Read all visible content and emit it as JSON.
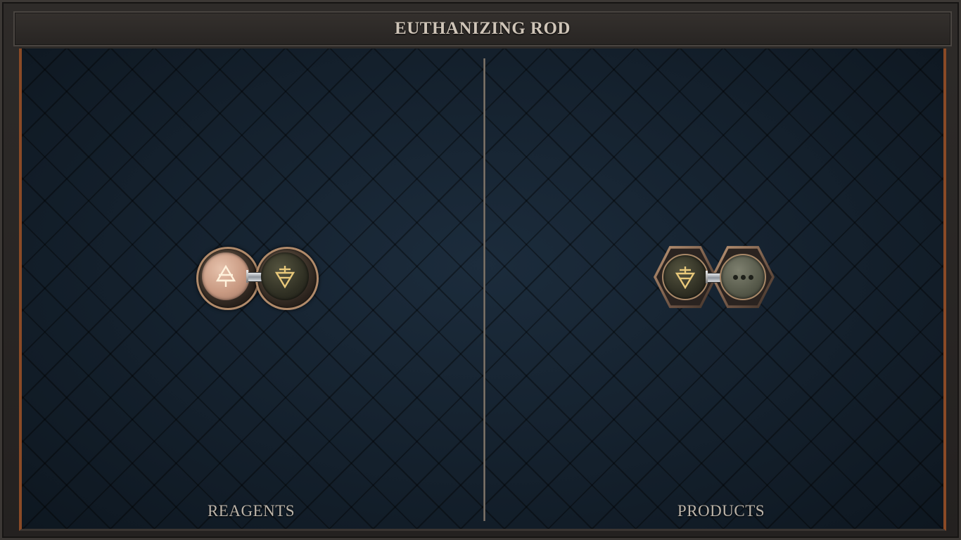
{
  "title": "EUTHANIZING ROD",
  "panels": {
    "left_label": "REAGENTS",
    "right_label": "PRODUCTS"
  },
  "reagents": [
    {
      "icon": "air-up-triangle-icon",
      "style": "light"
    },
    {
      "icon": "earth-down-triangle-icon",
      "style": "dark"
    }
  ],
  "products": [
    {
      "icon": "earth-down-triangle-icon",
      "style": "dark"
    },
    {
      "icon": "ellipsis-icon",
      "style": "grey"
    }
  ],
  "colors": {
    "accent_copper": "#8a4a26",
    "background_navy": "#152331",
    "glyph_gold": "#e8c87a"
  }
}
